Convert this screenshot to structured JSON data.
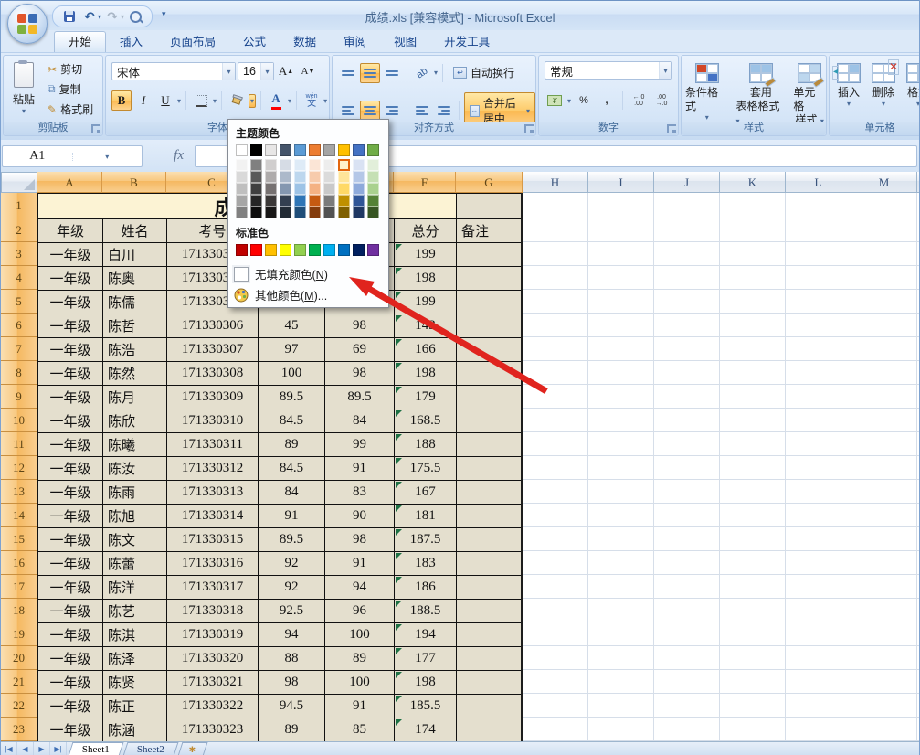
{
  "window": {
    "title": "成绩.xls  [兼容模式]  -  Microsoft Excel"
  },
  "tabs": [
    {
      "label": "开始",
      "active": true
    },
    {
      "label": "插入",
      "active": false
    },
    {
      "label": "页面布局",
      "active": false
    },
    {
      "label": "公式",
      "active": false
    },
    {
      "label": "数据",
      "active": false
    },
    {
      "label": "审阅",
      "active": false
    },
    {
      "label": "视图",
      "active": false
    },
    {
      "label": "开发工具",
      "active": false
    }
  ],
  "ribbon": {
    "clipboard": {
      "label": "剪贴板",
      "paste": "粘贴",
      "cut": "剪切",
      "copy": "复制",
      "format_painter": "格式刷"
    },
    "font": {
      "label": "字体",
      "family": "宋体",
      "size": "16",
      "bold": "B",
      "italic": "I",
      "underline": "U",
      "phonetic_top": "wén",
      "phonetic_bottom": "文"
    },
    "alignment": {
      "label": "对齐方式",
      "wrap_text": "自动换行",
      "merge_center": "合并后居中"
    },
    "number": {
      "label": "数字",
      "format": "常规",
      "percent": "%",
      "comma": ","
    },
    "styles": {
      "label": "样式",
      "conditional": "条件格式",
      "format_table_1": "套用",
      "format_table_2": "表格格式",
      "cell_styles_1": "单元格",
      "cell_styles_2": "样式"
    },
    "cells": {
      "label": "单元格",
      "insert": "插入",
      "delete": "删除",
      "format": "格式"
    }
  },
  "formula_bar": {
    "name_box": "A1",
    "fx": "fx"
  },
  "color_menu": {
    "theme_label": "主题颜色",
    "standard_label": "标准色",
    "no_fill": "无填充颜色(N)",
    "more_colors": "其他颜色(M)...",
    "theme_colors": [
      "#FFFFFF",
      "#000000",
      "#E7E6E6",
      "#44546A",
      "#5B9BD5",
      "#ED7D31",
      "#A5A5A5",
      "#FFC000",
      "#4472C4",
      "#70AD47"
    ],
    "theme_variants": [
      [
        "#F2F2F2",
        "#D9D9D9",
        "#BFBFBF",
        "#A6A6A6",
        "#808080"
      ],
      [
        "#808080",
        "#595959",
        "#404040",
        "#262626",
        "#0D0D0D"
      ],
      [
        "#D0CECE",
        "#AEABAB",
        "#767171",
        "#3B3838",
        "#181717"
      ],
      [
        "#D6DCE5",
        "#ACB9CA",
        "#8497B0",
        "#333F50",
        "#222B35"
      ],
      [
        "#DEEBF7",
        "#BDD7EE",
        "#9DC3E6",
        "#2E75B6",
        "#1F4E79"
      ],
      [
        "#FBE5D6",
        "#F7CBAC",
        "#F4B183",
        "#C55A11",
        "#843C0C"
      ],
      [
        "#EDEDED",
        "#DBDBDB",
        "#C9C9C9",
        "#7B7B7B",
        "#525252"
      ],
      [
        "#FFF2CC",
        "#FFE599",
        "#FFD966",
        "#BF9000",
        "#7F6000"
      ],
      [
        "#D9E2F3",
        "#B4C7E7",
        "#8EAADB",
        "#2F5597",
        "#1F3864"
      ],
      [
        "#E2EFDA",
        "#C5E0B4",
        "#A9D18E",
        "#548235",
        "#375623"
      ]
    ],
    "standard_colors": [
      "#C00000",
      "#FF0000",
      "#FFC000",
      "#FFFF00",
      "#92D050",
      "#00B050",
      "#00B0F0",
      "#0070C0",
      "#002060",
      "#7030A0"
    ],
    "selected_swatch": {
      "column": 7,
      "variant_row": 0,
      "color": "#FFF2CC"
    }
  },
  "grid": {
    "columns": [
      "A",
      "B",
      "C",
      "D",
      "E",
      "F",
      "G",
      "H",
      "I",
      "J",
      "K",
      "L",
      "M"
    ],
    "selected_columns_count": 7,
    "row_count": 23
  },
  "table": {
    "title": "成绩表",
    "headers": [
      "年级",
      "姓名",
      "考号",
      "",
      "",
      "总分",
      "备注"
    ],
    "rows": [
      [
        "一年级",
        "白川",
        "171330303",
        "",
        "",
        "199",
        ""
      ],
      [
        "一年级",
        "陈奥",
        "171330304",
        "",
        "",
        "198",
        ""
      ],
      [
        "一年级",
        "陈儒",
        "171330305",
        "",
        "",
        "199",
        ""
      ],
      [
        "一年级",
        "陈哲",
        "171330306",
        "45",
        "98",
        "143",
        ""
      ],
      [
        "一年级",
        "陈浩",
        "171330307",
        "97",
        "69",
        "166",
        ""
      ],
      [
        "一年级",
        "陈然",
        "171330308",
        "100",
        "98",
        "198",
        ""
      ],
      [
        "一年级",
        "陈月",
        "171330309",
        "89.5",
        "89.5",
        "179",
        ""
      ],
      [
        "一年级",
        "陈欣",
        "171330310",
        "84.5",
        "84",
        "168.5",
        ""
      ],
      [
        "一年级",
        "陈曦",
        "171330311",
        "89",
        "99",
        "188",
        ""
      ],
      [
        "一年级",
        "陈汝",
        "171330312",
        "84.5",
        "91",
        "175.5",
        ""
      ],
      [
        "一年级",
        "陈雨",
        "171330313",
        "84",
        "83",
        "167",
        ""
      ],
      [
        "一年级",
        "陈旭",
        "171330314",
        "91",
        "90",
        "181",
        ""
      ],
      [
        "一年级",
        "陈文",
        "171330315",
        "89.5",
        "98",
        "187.5",
        ""
      ],
      [
        "一年级",
        "陈蕾",
        "171330316",
        "92",
        "91",
        "183",
        ""
      ],
      [
        "一年级",
        "陈洋",
        "171330317",
        "92",
        "94",
        "186",
        ""
      ],
      [
        "一年级",
        "陈艺",
        "171330318",
        "92.5",
        "96",
        "188.5",
        ""
      ],
      [
        "一年级",
        "陈淇",
        "171330319",
        "94",
        "100",
        "194",
        ""
      ],
      [
        "一年级",
        "陈泽",
        "171330320",
        "88",
        "89",
        "177",
        ""
      ],
      [
        "一年级",
        "陈贤",
        "171330321",
        "98",
        "100",
        "198",
        ""
      ],
      [
        "一年级",
        "陈正",
        "171330322",
        "94.5",
        "91",
        "185.5",
        ""
      ],
      [
        "一年级",
        "陈涵",
        "171330323",
        "89",
        "85",
        "174",
        ""
      ]
    ]
  },
  "sheet_tabs": [
    "Sheet1",
    "Sheet2"
  ],
  "colors": {
    "cell_fill": "#E4DFCE",
    "title_fill": "#FCF3D4",
    "selected_header": "#F8C880",
    "arrow": "#E0241E",
    "selection_border": "#1C1C1C"
  }
}
